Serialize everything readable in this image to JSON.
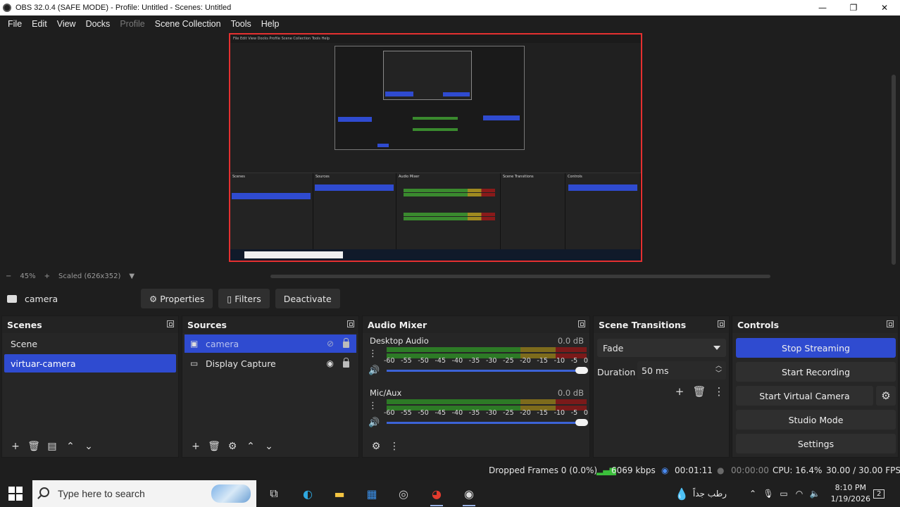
{
  "window": {
    "title": "OBS 32.0.4 (SAFE MODE) - Profile: Untitled - Scenes: Untitled",
    "minimize": "—",
    "restore": "❐",
    "close": "✕"
  },
  "menu": [
    "File",
    "Edit",
    "View",
    "Docks",
    "Profile",
    "Scene Collection",
    "Tools",
    "Help"
  ],
  "preview": {
    "zoom": "45%",
    "scaled": "Scaled (626x352)",
    "minus": "−",
    "plus": "+",
    "mirror_menu": "File  Edit  View  Docks  Profile  Scene Collection  Tools  Help"
  },
  "context": {
    "source_name": "camera",
    "properties": "Properties",
    "filters": "Filters",
    "deactivate": "Deactivate"
  },
  "scenes": {
    "title": "Scenes",
    "items": [
      {
        "label": "Scene",
        "selected": false
      },
      {
        "label": "virtuar-camera",
        "selected": true
      }
    ]
  },
  "sources": {
    "title": "Sources",
    "items": [
      {
        "label": "camera",
        "selected": true,
        "visible": false
      },
      {
        "label": "Display Capture",
        "selected": false,
        "visible": true
      }
    ]
  },
  "audio_mixer": {
    "title": "Audio Mixer",
    "channels": [
      {
        "name": "Desktop Audio",
        "db": "0.0 dB",
        "volume": 1.0
      },
      {
        "name": "Mic/Aux",
        "db": "0.0 dB",
        "volume": 1.0
      }
    ],
    "scale": [
      "-60",
      "-55",
      "-50",
      "-45",
      "-40",
      "-35",
      "-30",
      "-25",
      "-20",
      "-15",
      "-10",
      "-5",
      "0"
    ]
  },
  "scene_transitions": {
    "title": "Scene Transitions",
    "selected": "Fade",
    "duration_label": "Duration",
    "duration_value": "50 ms"
  },
  "controls": {
    "title": "Controls",
    "stop_streaming": "Stop Streaming",
    "start_recording": "Start Recording",
    "start_virtual_camera": "Start Virtual Camera",
    "studio_mode": "Studio Mode",
    "settings": "Settings"
  },
  "status": {
    "dropped_frames": "Dropped Frames 0 (0.0%)",
    "bitrate": "6069 kbps",
    "stream_time": "00:01:11",
    "record_time": "00:00:00",
    "cpu": "CPU: 16.4%",
    "fps": "30.00 / 30.00 FPS"
  },
  "taskbar": {
    "search_placeholder": "Type here to search",
    "weather": "رطب جداً",
    "time": "8:10 PM",
    "date": "1/19/2026",
    "notifications": "2"
  },
  "colors": {
    "accent_blue": "#2f4bd0",
    "preview_border": "#e53030",
    "bitrate_green": "#3bbf3b"
  }
}
